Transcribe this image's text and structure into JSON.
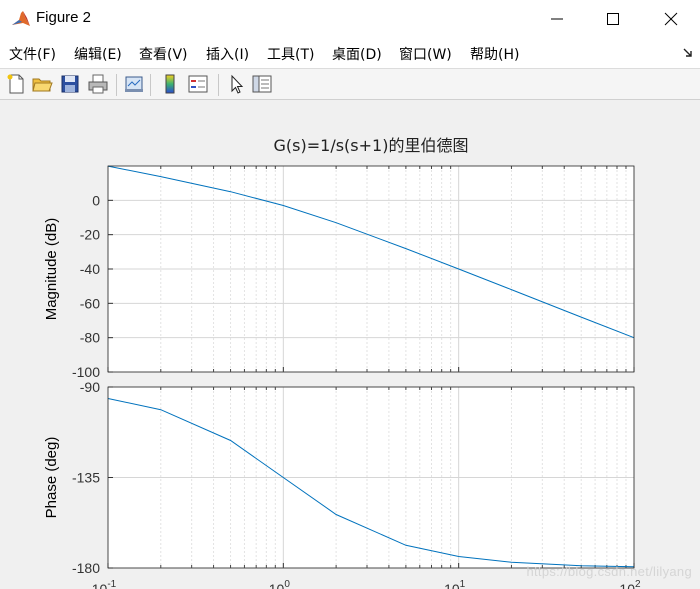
{
  "window": {
    "title": "Figure 2"
  },
  "menu": {
    "items": [
      {
        "label": "文件(F)"
      },
      {
        "label": "编辑(E)"
      },
      {
        "label": "查看(V)"
      },
      {
        "label": "插入(I)"
      },
      {
        "label": "工具(T)"
      },
      {
        "label": "桌面(D)"
      },
      {
        "label": "窗口(W)"
      },
      {
        "label": "帮助(H)"
      }
    ]
  },
  "toolbar": {
    "buttons": [
      "new-figure-icon",
      "open-file-icon",
      "save-icon",
      "print-icon",
      "link-plot-icon",
      "colorbar-icon",
      "legend-icon",
      "pointer-icon",
      "property-editor-icon"
    ]
  },
  "chart_data": {
    "type": "line",
    "title": "G(s)=1/s(s+1)的里伯德图",
    "xscale": "log",
    "xlim": [
      0.1,
      100
    ],
    "x_tick_labels": [
      "10^-1",
      "10^0",
      "10^1",
      "10^2"
    ],
    "grid": true,
    "subplots": [
      {
        "name": "magnitude",
        "ylabel": "Magnitude (dB)",
        "ylim": [
          -100,
          20
        ],
        "yticks": [
          0,
          -20,
          -40,
          -60,
          -80,
          -100
        ],
        "x": [
          0.1,
          0.2,
          0.5,
          1,
          2,
          5,
          10,
          20,
          50,
          100
        ],
        "y": [
          19.96,
          13.8,
          5.05,
          -3.01,
          -13.0,
          -28.1,
          -40.0,
          -52.0,
          -68.0,
          -80.0
        ],
        "color": "#0072bd"
      },
      {
        "name": "phase",
        "ylabel": "Phase (deg)",
        "ylim": [
          -180,
          -90
        ],
        "yticks": [
          -90,
          -135,
          -180
        ],
        "x": [
          0.1,
          0.2,
          0.5,
          1,
          2,
          5,
          10,
          20,
          50,
          100
        ],
        "y": [
          -95.7,
          -101.3,
          -116.6,
          -135.0,
          -153.4,
          -168.7,
          -174.3,
          -177.1,
          -178.9,
          -179.4
        ],
        "color": "#0072bd"
      }
    ]
  },
  "watermark": "https://blog.csdn.net/lilyang"
}
